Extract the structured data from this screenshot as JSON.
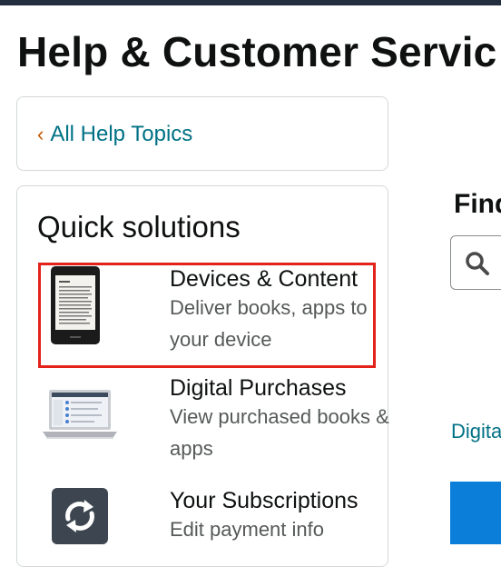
{
  "page": {
    "title": "Help & Customer Servic"
  },
  "back": {
    "label": "All Help Topics",
    "chevron": "‹"
  },
  "quick_solutions": {
    "title": "Quick solutions",
    "items": [
      {
        "name": "Devices & Content",
        "desc": "Deliver books, apps to your device",
        "icon": "kindle-device-icon",
        "highlighted": true
      },
      {
        "name": "Digital Purchases",
        "desc": "View purchased books & apps",
        "icon": "laptop-icon",
        "highlighted": false
      },
      {
        "name": "Your Subscriptions",
        "desc": "Edit payment info",
        "icon": "refresh-icon",
        "highlighted": false
      }
    ]
  },
  "find": {
    "label": "Find",
    "search_icon": "search-icon"
  },
  "right_link": {
    "label": "Digita"
  },
  "colors": {
    "link": "#007185",
    "chevron": "#c45500",
    "highlight": "#e3231a",
    "topbar": "#232f3e",
    "blue_block": "#0a7ed9"
  }
}
